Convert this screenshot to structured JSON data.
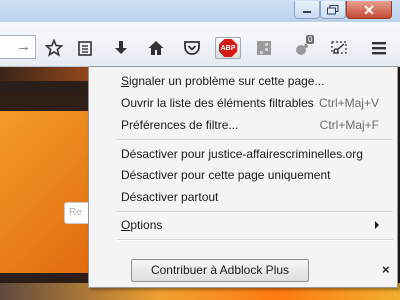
{
  "window": {
    "close_label": "✕"
  },
  "toolbar": {
    "go_icon": "arrow-right-icon",
    "abp_label": "ABP",
    "notification_count": "0"
  },
  "page": {
    "tooltip_fragment": "Re"
  },
  "menu": {
    "items": [
      {
        "label_pre": "",
        "mnemonic": "S",
        "label_post": "ignaler un problème sur cette page...",
        "shortcut": ""
      },
      {
        "label": "Ouvrir la liste des éléments filtrables",
        "shortcut": "Ctrl+Maj+V"
      },
      {
        "label": "Préférences de filtre...",
        "shortcut": "Ctrl+Maj+F"
      },
      {
        "label": "Désactiver pour justice-affairescriminelles.org"
      },
      {
        "label": "Désactiver pour cette page uniquement"
      },
      {
        "label": "Désactiver partout"
      },
      {
        "mnemonic": "O",
        "label_post": "ptions"
      }
    ],
    "contribute_label": "Contribuer à Adblock Plus",
    "close_label": "×"
  }
}
